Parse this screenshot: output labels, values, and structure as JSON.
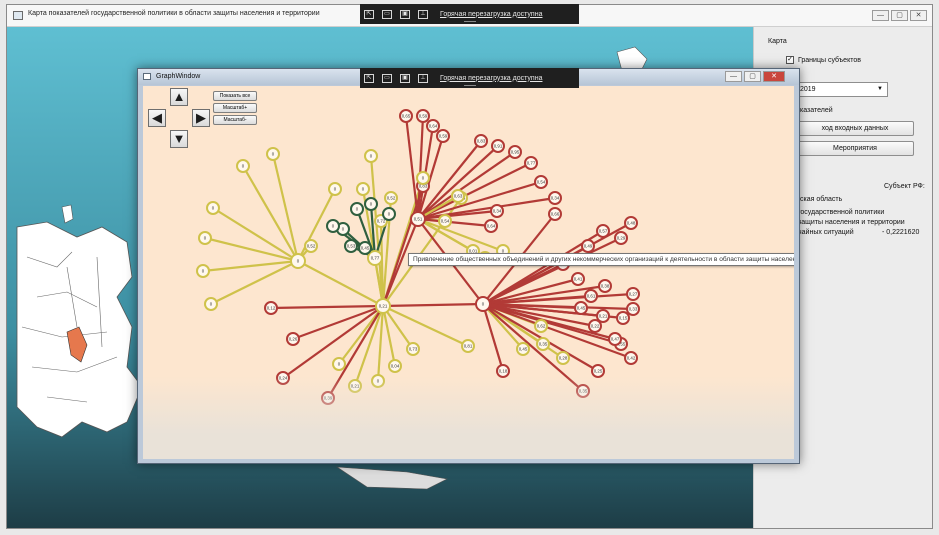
{
  "main_window": {
    "title": "Карта показателей государственной политики в области защиты населения и территории",
    "controls": {
      "minimize": "—",
      "maximize": "▢",
      "close": "✕"
    }
  },
  "hot_reload_toolbar": {
    "link_text": "Горячая перезагрузка доступна",
    "icons": [
      "select-element-icon",
      "display-layout-icon",
      "track-focus-icon",
      "pin-icon"
    ]
  },
  "side_panel": {
    "section_map": "Карта",
    "borders_checkbox": "Границы субъектов",
    "borders_checked": true,
    "year": "2019",
    "indicators_label": "казателей",
    "input_data_button": "ход входных данных",
    "measures_button": "Мероприятия",
    "subject_label": "Субъект РФ:",
    "line1": "ская область",
    "line2": "государственной политики",
    "line3": "защиты населения и территории",
    "line4": "чайных ситуаций",
    "value": "- 0,2221620"
  },
  "graph_window": {
    "title": "GraphWindow",
    "show_all_button": "Показать все",
    "zoom_in_button": "Масштаб+",
    "zoom_out_button": "Масштаб-",
    "tooltip": "Привлечение общественных объединений и других некоммерческих организаций к деятельности в области защиты населения и территорий от чрезвычайных ситуаций"
  },
  "colors": {
    "yellow": "#cfc24a",
    "red": "#b23a36",
    "green": "#2f5f3f",
    "canvas": "#fde6cf",
    "water": "#56b4c8",
    "region_highlight": "#e6784d"
  },
  "graph_nodes": [
    {
      "id": "c",
      "label": "0,21",
      "type": "yellow"
    },
    {
      "id": "L",
      "label": "0",
      "type": "yellow"
    },
    {
      "id": "R",
      "label": "0",
      "type": "red"
    },
    {
      "id": "U",
      "label": "0,51",
      "type": "red"
    },
    {
      "id": "M",
      "label": "0,83",
      "type": "red"
    },
    {
      "id": "G1",
      "label": "0,77",
      "type": "yellow"
    },
    {
      "id": "y1",
      "label": "0",
      "type": "yellow"
    },
    {
      "id": "y2",
      "label": "0",
      "type": "yellow"
    },
    {
      "id": "y3",
      "label": "0",
      "type": "yellow"
    },
    {
      "id": "y4",
      "label": "0",
      "type": "yellow"
    },
    {
      "id": "y5",
      "label": "0",
      "type": "yellow"
    },
    {
      "id": "y6",
      "label": "0",
      "type": "yellow"
    },
    {
      "id": "y7",
      "label": "0",
      "type": "yellow"
    },
    {
      "id": "y8",
      "label": "0,52",
      "type": "yellow"
    },
    {
      "id": "y9",
      "label": "0",
      "type": "yellow"
    },
    {
      "id": "y10",
      "label": "0,52",
      "type": "yellow"
    },
    {
      "id": "y11",
      "label": "0",
      "type": "yellow"
    },
    {
      "id": "y12",
      "label": "0,72",
      "type": "yellow"
    },
    {
      "id": "y13",
      "label": "0",
      "type": "yellow"
    },
    {
      "id": "y14",
      "label": "0,26",
      "type": "yellow"
    },
    {
      "id": "y15",
      "label": "0,73",
      "type": "yellow"
    },
    {
      "id": "y16",
      "label": "0,04",
      "type": "yellow"
    },
    {
      "id": "y17",
      "label": "0",
      "type": "yellow"
    },
    {
      "id": "y18",
      "label": "0,21",
      "type": "yellow"
    },
    {
      "id": "y19",
      "label": "0",
      "type": "yellow"
    },
    {
      "id": "y20",
      "label": "0,81",
      "type": "yellow"
    },
    {
      "id": "y21",
      "label": "0,54",
      "type": "yellow"
    },
    {
      "id": "y22",
      "label": "0,63",
      "type": "yellow"
    },
    {
      "id": "y23",
      "label": "0,01",
      "type": "yellow"
    },
    {
      "id": "y24",
      "label": "0,07",
      "type": "yellow"
    },
    {
      "id": "y25",
      "label": "0",
      "type": "yellow"
    },
    {
      "id": "y26",
      "label": "0,45",
      "type": "yellow"
    },
    {
      "id": "y27",
      "label": "0,35",
      "type": "yellow"
    },
    {
      "id": "y28",
      "label": "0,28",
      "type": "yellow"
    },
    {
      "id": "y29",
      "label": "0,62",
      "type": "yellow"
    },
    {
      "id": "g1",
      "label": "0,53",
      "type": "green"
    },
    {
      "id": "g2",
      "label": "0",
      "type": "green"
    },
    {
      "id": "g3",
      "label": "0",
      "type": "green"
    },
    {
      "id": "g4",
      "label": "0",
      "type": "green"
    },
    {
      "id": "g5",
      "label": "0",
      "type": "green"
    },
    {
      "id": "g6",
      "label": "0",
      "type": "green"
    },
    {
      "id": "g7",
      "label": "0,45",
      "type": "green"
    },
    {
      "id": "r1",
      "label": "0,65",
      "type": "red"
    },
    {
      "id": "r2",
      "label": "0,59",
      "type": "red"
    },
    {
      "id": "r3",
      "label": "0,64",
      "type": "red"
    },
    {
      "id": "r4",
      "label": "0,59",
      "type": "red"
    },
    {
      "id": "r5",
      "label": "0,83",
      "type": "red"
    },
    {
      "id": "r6",
      "label": "0,91",
      "type": "red"
    },
    {
      "id": "r7",
      "label": "0,95",
      "type": "red"
    },
    {
      "id": "r8",
      "label": "0,77",
      "type": "red"
    },
    {
      "id": "r9",
      "label": "0,54",
      "type": "red"
    },
    {
      "id": "r10",
      "label": "0,34",
      "type": "red"
    },
    {
      "id": "r11",
      "label": "0,34",
      "type": "red"
    },
    {
      "id": "r12",
      "label": "0,64",
      "type": "red"
    },
    {
      "id": "r13",
      "label": "0,92",
      "type": "red"
    },
    {
      "id": "r14",
      "label": "0,41",
      "type": "red"
    },
    {
      "id": "r15",
      "label": "0,45",
      "type": "red"
    },
    {
      "id": "r16",
      "label": "0,61",
      "type": "red"
    },
    {
      "id": "r17",
      "label": "0,38",
      "type": "red"
    },
    {
      "id": "r18",
      "label": "0,27",
      "type": "red"
    },
    {
      "id": "r19",
      "label": "0,29",
      "type": "red"
    },
    {
      "id": "r20",
      "label": "0,48",
      "type": "red"
    },
    {
      "id": "r21",
      "label": "0,57",
      "type": "red"
    },
    {
      "id": "r22",
      "label": "0,49",
      "type": "red"
    },
    {
      "id": "r23",
      "label": "0,66",
      "type": "red"
    },
    {
      "id": "r24",
      "label": "0,33",
      "type": "red"
    },
    {
      "id": "r25",
      "label": "0,15",
      "type": "red"
    },
    {
      "id": "r26",
      "label": "0,55",
      "type": "red"
    },
    {
      "id": "r27",
      "label": "0,42",
      "type": "red"
    },
    {
      "id": "r28",
      "label": "0,35",
      "type": "red"
    },
    {
      "id": "r29",
      "label": "0,25",
      "type": "red"
    },
    {
      "id": "r30",
      "label": "0,47",
      "type": "red"
    },
    {
      "id": "r31",
      "label": "0,21",
      "type": "red"
    },
    {
      "id": "r32",
      "label": "0,22",
      "type": "red"
    },
    {
      "id": "r33",
      "label": "0,18",
      "type": "red"
    },
    {
      "id": "r34",
      "label": "0,26",
      "type": "red"
    },
    {
      "id": "r35",
      "label": "0,24",
      "type": "red"
    },
    {
      "id": "r36",
      "label": "0,39",
      "type": "red"
    },
    {
      "id": "r37",
      "label": "0,12",
      "type": "red"
    }
  ],
  "graph_edges": [
    [
      "c",
      "L",
      "yellow"
    ],
    [
      "c",
      "R",
      "red"
    ],
    [
      "c",
      "U",
      "red"
    ],
    [
      "c",
      "G1",
      "yellow"
    ],
    [
      "L",
      "y1",
      "yellow"
    ],
    [
      "L",
      "y2",
      "yellow"
    ],
    [
      "L",
      "y3",
      "yellow"
    ],
    [
      "L",
      "y4",
      "yellow"
    ],
    [
      "L",
      "y5",
      "yellow"
    ],
    [
      "L",
      "y6",
      "yellow"
    ],
    [
      "L",
      "y7",
      "yellow"
    ],
    [
      "L",
      "y8",
      "yellow"
    ],
    [
      "c",
      "y9",
      "yellow"
    ],
    [
      "c",
      "y10",
      "yellow"
    ],
    [
      "c",
      "y11",
      "yellow"
    ],
    [
      "c",
      "y12",
      "yellow"
    ],
    [
      "c",
      "y13",
      "yellow"
    ],
    [
      "c",
      "y14",
      "yellow"
    ],
    [
      "c",
      "y15",
      "yellow"
    ],
    [
      "c",
      "y16",
      "yellow"
    ],
    [
      "c",
      "y17",
      "yellow"
    ],
    [
      "c",
      "y18",
      "yellow"
    ],
    [
      "c",
      "y19",
      "yellow"
    ],
    [
      "c",
      "y20",
      "yellow"
    ],
    [
      "c",
      "r37",
      "red"
    ],
    [
      "c",
      "r36",
      "red"
    ],
    [
      "c",
      "r35",
      "red"
    ],
    [
      "c",
      "r34",
      "red"
    ],
    [
      "c",
      "M",
      "red"
    ],
    [
      "G1",
      "g1",
      "green"
    ],
    [
      "G1",
      "g2",
      "green"
    ],
    [
      "G1",
      "g3",
      "green"
    ],
    [
      "G1",
      "g4",
      "green"
    ],
    [
      "G1",
      "g5",
      "green"
    ],
    [
      "G1",
      "g6",
      "green"
    ],
    [
      "G1",
      "g7",
      "green"
    ],
    [
      "U",
      "r1",
      "red"
    ],
    [
      "U",
      "r2",
      "red"
    ],
    [
      "U",
      "r3",
      "red"
    ],
    [
      "U",
      "r4",
      "red"
    ],
    [
      "U",
      "r5",
      "red"
    ],
    [
      "U",
      "r6",
      "red"
    ],
    [
      "U",
      "r7",
      "red"
    ],
    [
      "U",
      "r8",
      "red"
    ],
    [
      "U",
      "r9",
      "red"
    ],
    [
      "U",
      "r10",
      "red"
    ],
    [
      "U",
      "y21",
      "yellow"
    ],
    [
      "U",
      "y22",
      "yellow"
    ],
    [
      "U",
      "y23",
      "yellow"
    ],
    [
      "U",
      "y24",
      "yellow"
    ],
    [
      "U",
      "y25",
      "yellow"
    ],
    [
      "U",
      "r11",
      "red"
    ],
    [
      "U",
      "r12",
      "red"
    ],
    [
      "R",
      "r13",
      "red"
    ],
    [
      "R",
      "r14",
      "red"
    ],
    [
      "R",
      "r15",
      "red"
    ],
    [
      "R",
      "r16",
      "red"
    ],
    [
      "R",
      "r17",
      "red"
    ],
    [
      "R",
      "r18",
      "red"
    ],
    [
      "R",
      "r19",
      "red"
    ],
    [
      "R",
      "r20",
      "red"
    ],
    [
      "R",
      "r21",
      "red"
    ],
    [
      "R",
      "r22",
      "red"
    ],
    [
      "R",
      "r23",
      "red"
    ],
    [
      "R",
      "r24",
      "red"
    ],
    [
      "R",
      "r25",
      "red"
    ],
    [
      "R",
      "y26",
      "yellow"
    ],
    [
      "R",
      "y27",
      "yellow"
    ],
    [
      "R",
      "y28",
      "yellow"
    ],
    [
      "R",
      "y29",
      "yellow"
    ],
    [
      "R",
      "r26",
      "red"
    ],
    [
      "R",
      "r27",
      "red"
    ],
    [
      "R",
      "r28",
      "red"
    ],
    [
      "R",
      "r29",
      "red"
    ],
    [
      "R",
      "r30",
      "red"
    ],
    [
      "R",
      "r31",
      "red"
    ],
    [
      "R",
      "r32",
      "red"
    ],
    [
      "R",
      "r33",
      "red"
    ],
    [
      "R",
      "U",
      "red"
    ]
  ]
}
